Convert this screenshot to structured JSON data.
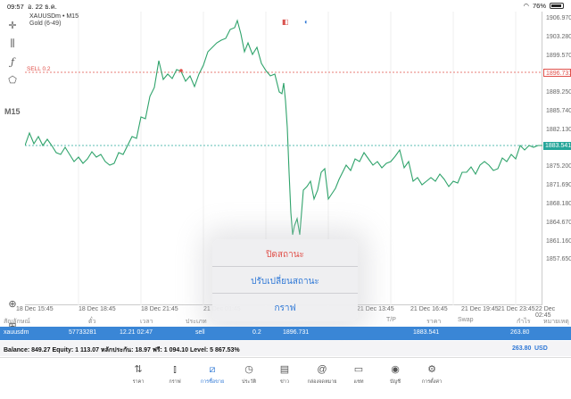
{
  "status_bar": {
    "time": "09:57",
    "date": "อ. 22 ธ.ค.",
    "battery": "76%",
    "battery_level": 0.76
  },
  "symbol": {
    "title": "XAUUSDm • M15",
    "subtitle": "Gold (6-49)"
  },
  "timeframe": "M15",
  "price_axis": [
    "1906.970",
    "1903.280",
    "1899.570",
    "1892.750",
    "1889.250",
    "1885.740",
    "1882.130",
    "1878.710",
    "1875.200",
    "1871.690",
    "1868.180",
    "1864.670",
    "1861.160",
    "1857.650"
  ],
  "sell_tag": "SELL 0.2",
  "sell_price_tag": "1896.731",
  "current_price_tag": "1883.541",
  "time_axis": [
    "18 Dec 15:45",
    "18 Dec 18:45",
    "18 Dec 21:45",
    "21 Dec 01:45",
    "21 Dec 13:45",
    "21 Dec 16:45",
    "21 Dec 19:45",
    "21 Dec 23:45",
    "22 Dec 02:45"
  ],
  "popup": {
    "close_position": "ปิดสถานะ",
    "modify_position": "ปรับเปลี่ยนสถานะ",
    "chart": "กราฟ"
  },
  "trade_header": {
    "symbol": "สัญลักษณ์",
    "ticket": "ตั๋ว",
    "time": "เวลา",
    "type": "ประเภท",
    "tp": "T/P",
    "price": "ราคา",
    "swap": "Swap",
    "profit": "กำไร",
    "comment": "หมายเหตุ"
  },
  "trade_row": {
    "symbol": "xauusdm",
    "ticket": "57733281",
    "time": "12.21 02:47",
    "type": "sell",
    "volume": "0.2",
    "open_price": "1896.731",
    "current_price": "1883.541",
    "profit": "263.80"
  },
  "balance": {
    "text": "Balance: 849.27 Equity: 1 113.07 หลักประกัน: 18.97 ฟรี: 1 094.10 Level: 5 867.53%",
    "total": "263.80",
    "currency": "USD"
  },
  "tabs": [
    {
      "label": "ราคา",
      "icon": "quotes-icon"
    },
    {
      "label": "กราฟ",
      "icon": "chart-icon"
    },
    {
      "label": "การซื้อขาย",
      "icon": "trade-icon"
    },
    {
      "label": "ประวัติ",
      "icon": "history-icon"
    },
    {
      "label": "ข่าว",
      "icon": "news-icon"
    },
    {
      "label": "กล่องจดหมาย",
      "icon": "mailbox-icon"
    },
    {
      "label": "แชท",
      "icon": "chat-icon"
    },
    {
      "label": "บัญชี",
      "icon": "account-icon"
    },
    {
      "label": "การตั้งค่า",
      "icon": "settings-icon"
    }
  ],
  "colors": {
    "line": "#2fa36b",
    "sell": "#e0504a",
    "accent": "#2f78d6",
    "current": "#26a69a"
  }
}
